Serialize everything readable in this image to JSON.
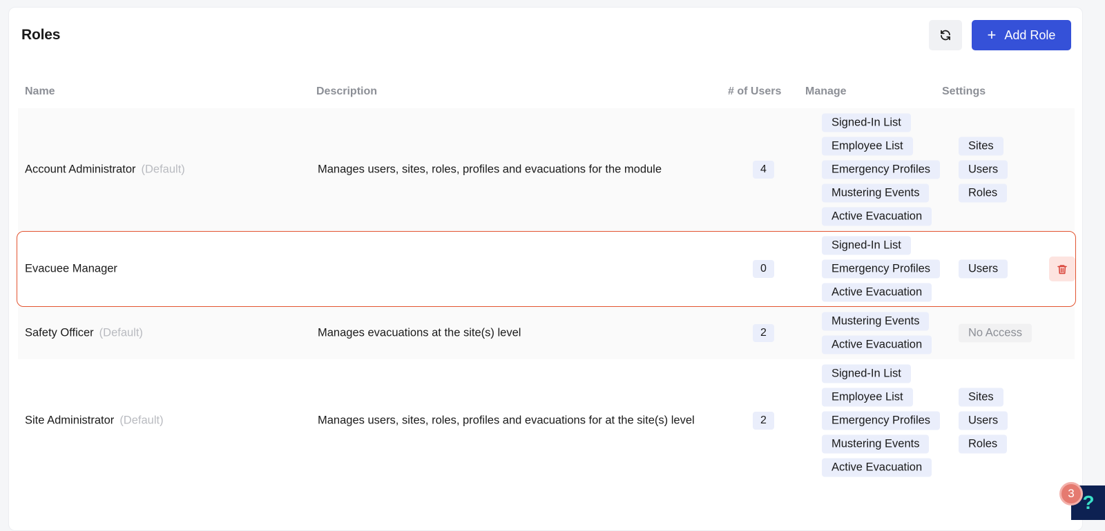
{
  "page": {
    "title": "Roles"
  },
  "toolbar": {
    "add_label": "Add Role",
    "refresh_icon": "refresh-icon",
    "plus_glyph": "+"
  },
  "table": {
    "headers": [
      "Name",
      "Description",
      "# of Users",
      "Manage",
      "Settings"
    ],
    "default_label": "(Default)",
    "rows": [
      {
        "name": "Account Administrator",
        "is_default": true,
        "description": "Manages users, sites, roles, profiles and evacuations for the module",
        "users": "4",
        "manage": [
          "Signed-In List",
          "Employee List",
          "Emergency Profiles",
          "Mustering Events",
          "Active Evacuation"
        ],
        "settings": [
          "Sites",
          "Users",
          "Roles"
        ]
      },
      {
        "name": "Evacuee Manager",
        "is_default": false,
        "description": "",
        "users": "0",
        "manage": [
          "Signed-In List",
          "Emergency Profiles",
          "Active Evacuation"
        ],
        "settings": [
          "Users"
        ],
        "highlighted": true,
        "deletable": true
      },
      {
        "name": "Safety Officer",
        "is_default": true,
        "description": "Manages evacuations at the site(s) level",
        "users": "2",
        "manage": [
          "Mustering Events",
          "Active Evacuation"
        ],
        "settings_text": "No Access"
      },
      {
        "name": "Site Administrator",
        "is_default": true,
        "description": "Manages users, sites, roles, profiles and evacuations for at the site(s) level",
        "users": "2",
        "manage": [
          "Signed-In List",
          "Employee List",
          "Emergency Profiles",
          "Mustering Events",
          "Active Evacuation"
        ],
        "settings": [
          "Sites",
          "Users",
          "Roles"
        ]
      }
    ]
  },
  "help": {
    "glyph": "?",
    "badge_count": "3"
  },
  "colors": {
    "accent": "#3551d8",
    "highlight_border": "#e2532f",
    "tag_bg": "#eaeefb",
    "delete_icon": "#d9453a"
  }
}
